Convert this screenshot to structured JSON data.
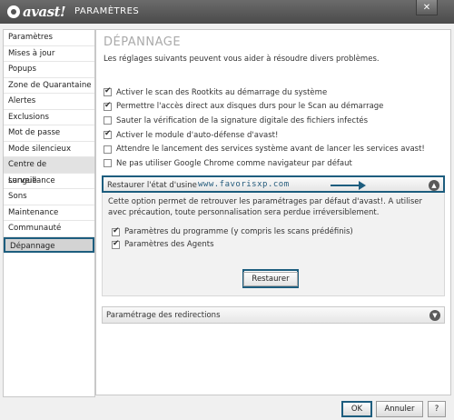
{
  "titlebar": {
    "brand": "avast!",
    "section": "PARAMÈTRES",
    "close_glyph": "✕"
  },
  "sidebar": {
    "items": [
      {
        "label": "Paramètres"
      },
      {
        "label": "Mises à jour"
      },
      {
        "label": "Popups"
      },
      {
        "label": "Zone de Quarantaine"
      },
      {
        "label": "Alertes"
      },
      {
        "label": "Exclusions"
      },
      {
        "label": "Mot de passe"
      },
      {
        "label": "Mode silencieux"
      },
      {
        "label": "Centre de surveillance"
      },
      {
        "label": "Langue"
      },
      {
        "label": "Sons"
      },
      {
        "label": "Maintenance"
      },
      {
        "label": "Communauté"
      },
      {
        "label": "Dépannage"
      }
    ],
    "active": "Dépannage"
  },
  "main": {
    "title": "DÉPANNAGE",
    "description": "Les réglages suivants peuvent vous aider à résoudre divers problèmes.",
    "options": [
      {
        "label": "Activer le scan des Rootkits au démarrage du système",
        "checked": true
      },
      {
        "label": "Permettre l'accès direct aux disques durs pour le Scan au démarrage",
        "checked": true
      },
      {
        "label": "Sauter la vérification de la signature digitale des fichiers infectés",
        "checked": false
      },
      {
        "label": "Activer le module d'auto-défense d'avast!",
        "checked": true
      },
      {
        "label": "Attendre le lancement des services système avant de lancer les services avast!",
        "checked": false
      },
      {
        "label": "Ne pas utiliser Google Chrome comme navigateur par défaut",
        "checked": false
      }
    ],
    "restore_section": {
      "header": "Restaurer l'état d'usine",
      "watermark": "www.favorisxp.com",
      "description": "Cette option permet de retrouver les paramétrages par défaut d'avast!. A utiliser avec précaution, toute personnalisation sera perdue irréversiblement.",
      "sub_options": [
        {
          "label": "Paramètres du programme (y compris les scans prédéfinis)",
          "checked": true
        },
        {
          "label": "Paramètres des Agents",
          "checked": true
        }
      ],
      "button": "Restaurer"
    },
    "redirect_section": {
      "header": "Paramétrage des redirections"
    }
  },
  "footer": {
    "ok": "OK",
    "cancel": "Annuler",
    "help": "?"
  },
  "colors": {
    "highlight": "#1d5d7e",
    "titlebar": "#4a4a4a"
  },
  "icons": {
    "collapse": "chevron-up-icon",
    "expand": "chevron-down-icon",
    "close": "close-icon"
  }
}
